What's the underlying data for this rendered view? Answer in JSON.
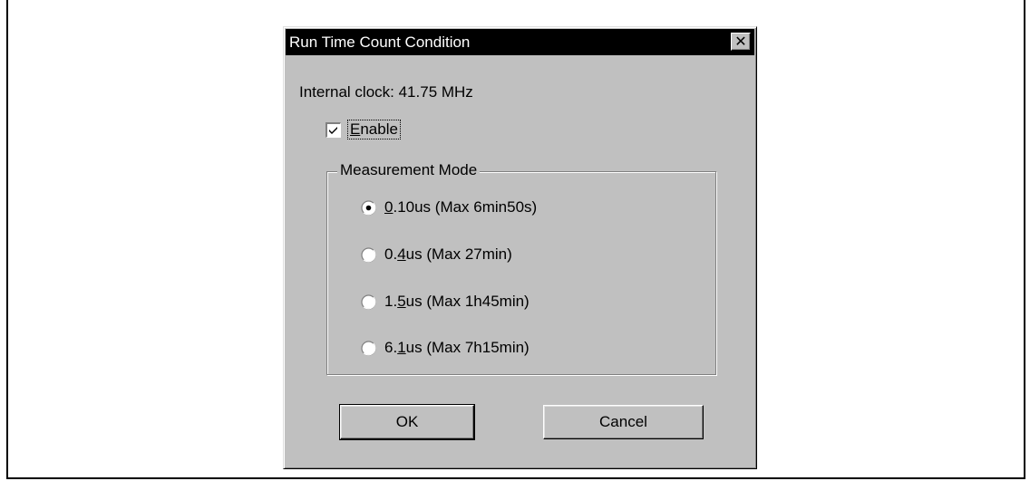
{
  "dialog": {
    "title": "Run Time Count Condition",
    "close_glyph": "✕",
    "internal_clock_label": "Internal clock: 41.75 MHz",
    "enable": {
      "label_prefix": "",
      "label_mnemonic": "E",
      "label_rest": "nable",
      "checked": true
    },
    "measurement_mode": {
      "legend": "Measurement Mode",
      "options": [
        {
          "pre": "",
          "mnemonic": "0",
          "post": ".10us (Max 6min50s)",
          "selected": true
        },
        {
          "pre": "0.",
          "mnemonic": "4",
          "post": "us (Max 27min)",
          "selected": false
        },
        {
          "pre": "1.",
          "mnemonic": "5",
          "post": "us (Max 1h45min)",
          "selected": false
        },
        {
          "pre": "6.",
          "mnemonic": "1",
          "post": "us (Max 7h15min)",
          "selected": false
        }
      ]
    },
    "buttons": {
      "ok_label": "OK",
      "cancel_label": "Cancel"
    }
  }
}
